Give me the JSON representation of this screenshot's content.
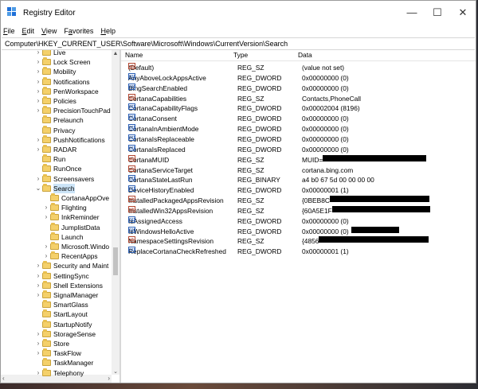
{
  "window": {
    "title": "Registry Editor",
    "controls": [
      "—",
      "☐",
      "✕"
    ]
  },
  "menu": [
    {
      "accel": "F",
      "rest": "ile"
    },
    {
      "accel": "E",
      "rest": "dit"
    },
    {
      "accel": "V",
      "rest": "iew"
    },
    {
      "accel": "",
      "pre": "F",
      "accel2": "a",
      "rest": "vorites"
    },
    {
      "accel": "H",
      "rest": "elp"
    }
  ],
  "address": "Computer\\HKEY_CURRENT_USER\\Software\\Microsoft\\Windows\\CurrentVersion\\Search",
  "tree": [
    {
      "label": "Live",
      "level": 0,
      "chev": "›"
    },
    {
      "label": "Lock Screen",
      "level": 0,
      "chev": "›"
    },
    {
      "label": "Mobility",
      "level": 0,
      "chev": "›"
    },
    {
      "label": "Notifications",
      "level": 0,
      "chev": "›"
    },
    {
      "label": "PenWorkspace",
      "level": 0,
      "chev": "›"
    },
    {
      "label": "Policies",
      "level": 0,
      "chev": "›"
    },
    {
      "label": "PrecisionTouchPad",
      "level": 0,
      "chev": "›"
    },
    {
      "label": "Prelaunch",
      "level": 0,
      "chev": ""
    },
    {
      "label": "Privacy",
      "level": 0,
      "chev": ""
    },
    {
      "label": "PushNotifications",
      "level": 0,
      "chev": "›"
    },
    {
      "label": "RADAR",
      "level": 0,
      "chev": "›"
    },
    {
      "label": "Run",
      "level": 0,
      "chev": ""
    },
    {
      "label": "RunOnce",
      "level": 0,
      "chev": ""
    },
    {
      "label": "Screensavers",
      "level": 0,
      "chev": "›"
    },
    {
      "label": "Search",
      "level": 0,
      "chev": "⌄",
      "selected": true
    },
    {
      "label": "CortanaAppOve",
      "level": 1,
      "chev": ""
    },
    {
      "label": "Flighting",
      "level": 1,
      "chev": "›"
    },
    {
      "label": "InkReminder",
      "level": 1,
      "chev": "›"
    },
    {
      "label": "JumplistData",
      "level": 1,
      "chev": ""
    },
    {
      "label": "Launch",
      "level": 1,
      "chev": ""
    },
    {
      "label": "Microsoft.Windo",
      "level": 1,
      "chev": "›"
    },
    {
      "label": "RecentApps",
      "level": 1,
      "chev": "›"
    },
    {
      "label": "Security and Maint",
      "level": 0,
      "chev": "›"
    },
    {
      "label": "SettingSync",
      "level": 0,
      "chev": "›"
    },
    {
      "label": "Shell Extensions",
      "level": 0,
      "chev": "›"
    },
    {
      "label": "SignalManager",
      "level": 0,
      "chev": "›"
    },
    {
      "label": "SmartGlass",
      "level": 0,
      "chev": ""
    },
    {
      "label": "StartLayout",
      "level": 0,
      "chev": ""
    },
    {
      "label": "StartupNotify",
      "level": 0,
      "chev": ""
    },
    {
      "label": "StorageSense",
      "level": 0,
      "chev": "›"
    },
    {
      "label": "Store",
      "level": 0,
      "chev": "›"
    },
    {
      "label": "TaskFlow",
      "level": 0,
      "chev": "›"
    },
    {
      "label": "TaskManager",
      "level": 0,
      "chev": ""
    },
    {
      "label": "Telephony",
      "level": 0,
      "chev": "›"
    }
  ],
  "columns": {
    "name": "Name",
    "type": "Type",
    "data": "Data"
  },
  "values": [
    {
      "name": "(Default)",
      "type": "REG_SZ",
      "data": "(value not set)",
      "icon": "sz"
    },
    {
      "name": "AnyAboveLockAppsActive",
      "type": "REG_DWORD",
      "data": "0x00000000 (0)",
      "icon": "bin"
    },
    {
      "name": "BingSearchEnabled",
      "type": "REG_DWORD",
      "data": "0x00000000 (0)",
      "icon": "bin"
    },
    {
      "name": "CortanaCapabilities",
      "type": "REG_SZ",
      "data": "Contacts,PhoneCall",
      "icon": "sz"
    },
    {
      "name": "CortanaCapabilityFlags",
      "type": "REG_DWORD",
      "data": "0x00002004 (8196)",
      "icon": "bin"
    },
    {
      "name": "CortanaConsent",
      "type": "REG_DWORD",
      "data": "0x00000000 (0)",
      "icon": "bin"
    },
    {
      "name": "CortanaInAmbientMode",
      "type": "REG_DWORD",
      "data": "0x00000000 (0)",
      "icon": "bin"
    },
    {
      "name": "CortanaIsReplaceable",
      "type": "REG_DWORD",
      "data": "0x00000000 (0)",
      "icon": "bin"
    },
    {
      "name": "CortanaIsReplaced",
      "type": "REG_DWORD",
      "data": "0x00000000 (0)",
      "icon": "bin"
    },
    {
      "name": "CortanaMUID",
      "type": "REG_SZ",
      "data": "MUID=",
      "icon": "sz",
      "redact": 130
    },
    {
      "name": "CortanaServiceTarget",
      "type": "REG_SZ",
      "data": "cortana.bing.com",
      "icon": "sz"
    },
    {
      "name": "CortanaStateLastRun",
      "type": "REG_BINARY",
      "data": "a4 b0 67 5d 00 00 00 00",
      "icon": "bin"
    },
    {
      "name": "DeviceHistoryEnabled",
      "type": "REG_DWORD",
      "data": "0x00000001 (1)",
      "icon": "bin"
    },
    {
      "name": "InstalledPackagedAppsRevision",
      "type": "REG_SZ",
      "data": "{0BEB8C",
      "icon": "sz",
      "redact": 125
    },
    {
      "name": "InstalledWin32AppsRevision",
      "type": "REG_SZ",
      "data": "{60A5E1F",
      "icon": "sz",
      "redact": 123
    },
    {
      "name": "IsAssignedAccess",
      "type": "REG_DWORD",
      "data": "0x00000000 (0)",
      "icon": "bin"
    },
    {
      "name": "IsWindowsHelloActive",
      "type": "REG_DWORD",
      "data": "0x00000000 (0)",
      "icon": "bin",
      "redact": 60
    },
    {
      "name": "NamespaceSettingsRevision",
      "type": "REG_SZ",
      "data": "{4856",
      "icon": "sz",
      "redact": 138
    },
    {
      "name": "ReplaceCortanaCheckRefreshed",
      "type": "REG_DWORD",
      "data": "0x00000001 (1)",
      "icon": "bin"
    }
  ]
}
